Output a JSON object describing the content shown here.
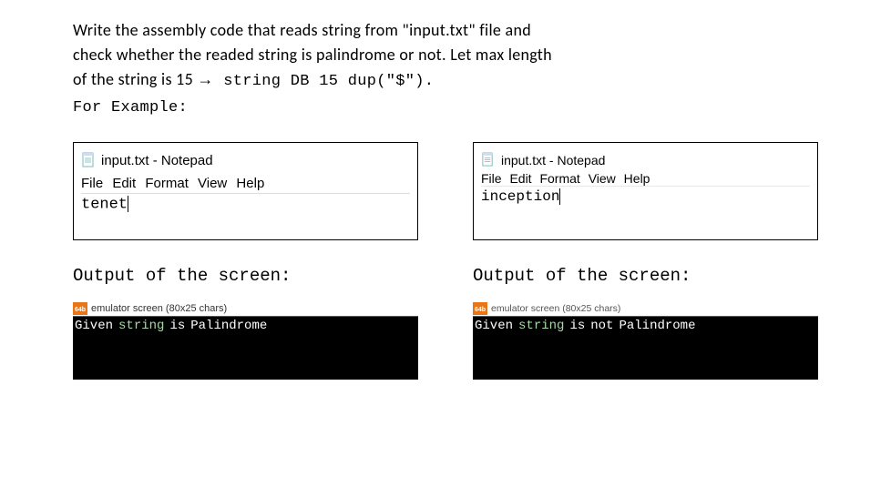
{
  "problem": {
    "line1": "Write the assembly code that reads string from \"input.txt\" file and",
    "line2": "check whether the readed string is palindrome or not.   Let max length",
    "line3a": "of the string is 15 ",
    "arrow": "→",
    "line3b": " string  DB 15 dup(\"$\").",
    "line4": "For Example:"
  },
  "left": {
    "notepad": {
      "title": "input.txt - Notepad",
      "menu": "File  Edit  Format  View  Help",
      "content": "tenet"
    },
    "output_label": "Output of the screen:",
    "emulator": {
      "icon_text": "64b",
      "title": "emulator screen (80x25 chars)",
      "output_words": [
        "Given",
        "string",
        "is",
        "Palindrome"
      ]
    }
  },
  "right": {
    "notepad": {
      "title": "input.txt - Notepad",
      "menu": "File  Edit  Format  View  Help",
      "content": "inception"
    },
    "output_label": "Output of the screen:",
    "emulator": {
      "icon_text": "64b",
      "title": "emulator screen (80x25 chars)",
      "output_words": [
        "Given",
        "string",
        "is",
        "not",
        "Palindrome"
      ]
    }
  }
}
